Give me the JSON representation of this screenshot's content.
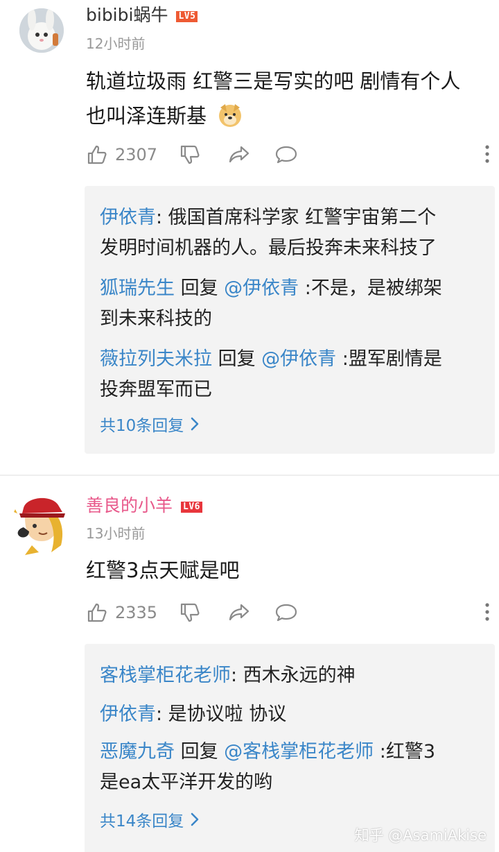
{
  "colors": {
    "link": "#3a86c8",
    "pink_name": "#e8588a",
    "lv5": "#ee5a33",
    "lv6": "#e8363c"
  },
  "comments": [
    {
      "user": "bibibi蜗牛",
      "level": "LV5",
      "time": "12小时前",
      "text_lines": [
        "轨道垃圾雨  红警三是写实的吧 剧情有个人",
        "也叫泽连斯基"
      ],
      "emoji": "doge-emoji",
      "likes": "2307",
      "replies": [
        {
          "name": "伊依青",
          "reply_word": "",
          "target": "",
          "text_lines": [
            ": 俄国首席科学家 红警宇宙第二个",
            "发明时间机器的人。最后投奔未来科技了"
          ]
        },
        {
          "name": "狐瑞先生",
          "reply_word": " 回复 ",
          "target": "@伊依青",
          "text_lines": [
            " :不是，是被绑架",
            "到未来科技的"
          ]
        },
        {
          "name": "薇拉列夫米拉",
          "reply_word": " 回复 ",
          "target": "@伊依青",
          "text_lines": [
            " :盟军剧情是",
            "投奔盟军而已"
          ]
        }
      ],
      "more_replies": "共10条回复"
    },
    {
      "user": "善良的小羊",
      "level": "LV6",
      "time": "13小时前",
      "text_lines": [
        "红警3点天赋是吧"
      ],
      "likes": "2335",
      "replies": [
        {
          "name": "客栈掌柜花老师",
          "reply_word": "",
          "target": "",
          "text_lines": [
            ": 西木永远的神"
          ]
        },
        {
          "name": "伊依青",
          "reply_word": "",
          "target": "",
          "text_lines": [
            ": 是协议啦 协议"
          ]
        },
        {
          "name": "恶魔九奇",
          "reply_word": " 回复 ",
          "target": "@客栈掌柜花老师",
          "text_lines": [
            " :红警3",
            "是ea太平洋开发的哟"
          ]
        }
      ],
      "more_replies": "共14条回复"
    }
  ],
  "watermark": "知乎 @AsamiAkise"
}
